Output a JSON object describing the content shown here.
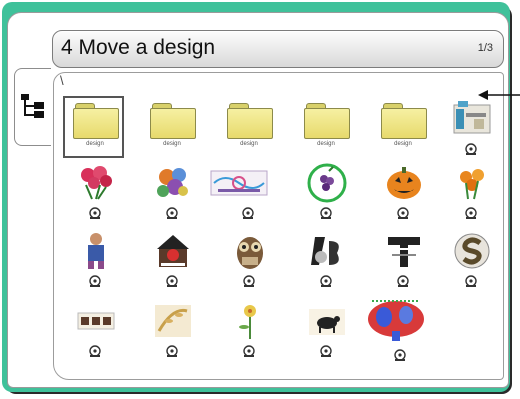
{
  "title": {
    "text": "4 Move a design",
    "page_indicator": "1/3"
  },
  "path": "\\",
  "side_tab": {
    "icon": "tree-icon"
  },
  "folders": [
    {
      "label": "design"
    },
    {
      "label": "design"
    },
    {
      "label": "design"
    },
    {
      "label": "design"
    },
    {
      "label": "design"
    }
  ],
  "designs": [
    {
      "icon": "design-display-thumbnail"
    },
    {
      "icon": "design-roses-thumbnail"
    },
    {
      "icon": "design-floral-thumbnail"
    },
    {
      "icon": "design-border-thumbnail"
    },
    {
      "icon": "design-grapes-thumbnail"
    },
    {
      "icon": "design-pumpkin-thumbnail"
    },
    {
      "icon": "design-tulips-thumbnail"
    },
    {
      "icon": "design-figure-thumbnail"
    },
    {
      "icon": "design-house-thumbnail"
    },
    {
      "icon": "design-owl-thumbnail"
    },
    {
      "icon": "design-letters-thumbnail"
    },
    {
      "icon": "design-t-logo-thumbnail"
    },
    {
      "icon": "design-s-logo-thumbnail"
    },
    {
      "icon": "design-labels-thumbnail"
    },
    {
      "icon": "design-leaf-thumbnail"
    },
    {
      "icon": "design-flower-thumbnail"
    },
    {
      "icon": "design-cow-thumbnail"
    },
    {
      "icon": "design-map-thumbnail"
    }
  ],
  "colors": {
    "frame": "#3fc19a",
    "folder": "#e7da6c"
  }
}
